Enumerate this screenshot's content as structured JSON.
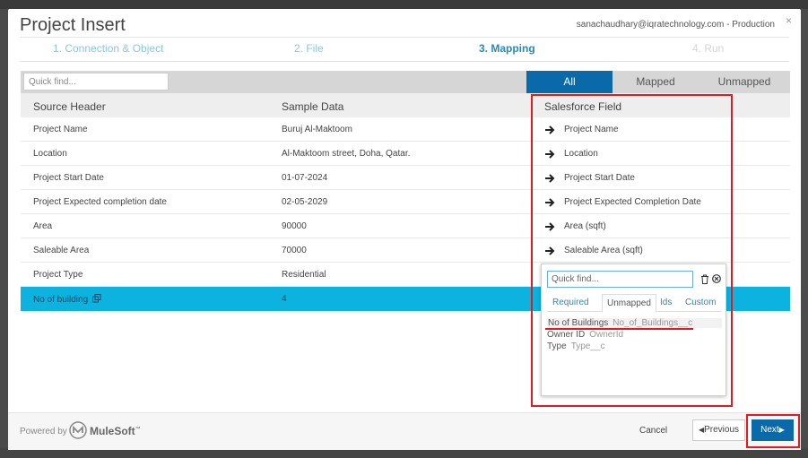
{
  "modal": {
    "title": "Project Insert",
    "user": "sanachaudhary@iqratechnology.com - Production",
    "close_glyph": "×"
  },
  "steps": [
    {
      "label": "1. Connection & Object"
    },
    {
      "label": "2. File"
    },
    {
      "label": "3. Mapping"
    },
    {
      "label": "4. Run"
    }
  ],
  "filter": {
    "quick_find_placeholder": "Quick find...",
    "segments": [
      "All",
      "Mapped",
      "Unmapped"
    ]
  },
  "table": {
    "headers": [
      "Source Header",
      "Sample Data",
      "Salesforce Field"
    ],
    "rows": [
      {
        "source": "Project Name",
        "sample": "Buruj Al-Maktoom",
        "field": "Project Name"
      },
      {
        "source": "Location",
        "sample": "Al-Maktoom street, Doha, Qatar.",
        "field": "Location"
      },
      {
        "source": "Project Start Date",
        "sample": "01-07-2024",
        "field": "Project Start Date"
      },
      {
        "source": "Project Expected completion date",
        "sample": "02-05-2029",
        "field": "Project Expected Completion Date"
      },
      {
        "source": "Area",
        "sample": "90000",
        "field": "Area (sqft)"
      },
      {
        "source": "Saleable Area",
        "sample": "70000",
        "field": "Saleable Area (sqft)"
      },
      {
        "source": "Project Type",
        "sample": "Residential",
        "field": ""
      },
      {
        "source": "No of building",
        "sample": "4",
        "field": ""
      }
    ]
  },
  "popup": {
    "placeholder": "Quick find...",
    "tabs": [
      "Required",
      "Unmapped",
      "Ids",
      "Custom"
    ],
    "options": [
      {
        "label": "No of Buildings",
        "api": "No_of_Buildings__c"
      },
      {
        "label": "Owner ID",
        "api": "OwnerId"
      },
      {
        "label": "Type",
        "api": "Type__c"
      }
    ]
  },
  "footer": {
    "powered_by": "Powered by",
    "brand": "MuleSoft",
    "brand_tm": "™",
    "cancel": "Cancel",
    "previous": "Previous",
    "next": "Next"
  },
  "colors": {
    "accent": "#0a69a8",
    "selected_row": "#0bb3de",
    "highlight": "#e11b22"
  }
}
